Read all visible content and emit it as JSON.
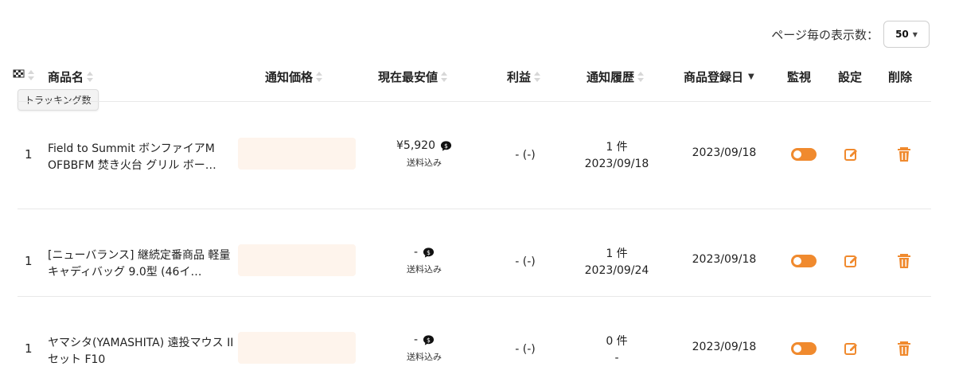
{
  "pagination": {
    "per_page_label": "ページ毎の表示数：",
    "per_page_value": "50"
  },
  "columns": {
    "tracking": "",
    "product_name": "商品名",
    "notify_price": "通知価格",
    "lowest_price": "現在最安値",
    "profit": "利益",
    "notify_history": "通知履歴",
    "register_date": "商品登録日",
    "monitor": "監視",
    "settings": "設定",
    "delete": "削除"
  },
  "tooltip": {
    "text": "トラッキング数"
  },
  "icons": {
    "tracking": "checkered-flag-icon",
    "sort": "sort-icon",
    "sort_active": "sort-down-icon",
    "lowest_price_badge": "speech-bubble-dollar-icon",
    "edit": "edit-icon",
    "delete": "trash-icon"
  },
  "colors": {
    "accent": "#F08A2E",
    "price_box_bg": "#FEF4EC",
    "divider": "#E8E8E8"
  },
  "rows": [
    {
      "count": "1",
      "product_name": "Field to Summit ボンファイアM OFBBFM 焚き火台 グリル ボー…",
      "notify_price": "",
      "lowest_price": "¥5,920",
      "shipping": "送料込み",
      "profit": "- (-)",
      "history_count": "1 件",
      "history_date": "2023/09/18",
      "register_date": "2023/09/18",
      "monitor_on": true
    },
    {
      "count": "1",
      "product_name": "[ニューバランス] 継続定番商品 軽量 キャディバッグ 9.0型 (46イ…",
      "notify_price": "",
      "lowest_price": "-",
      "shipping": "送料込み",
      "profit": "- (-)",
      "history_count": "1 件",
      "history_date": "2023/09/24",
      "register_date": "2023/09/18",
      "monitor_on": true
    },
    {
      "count": "1",
      "product_name": "ヤマシタ(YAMASHITA) 遠投マウス IIセット F10",
      "notify_price": "",
      "lowest_price": "-",
      "shipping": "送料込み",
      "profit": "- (-)",
      "history_count": "0 件",
      "history_date": "-",
      "register_date": "2023/09/18",
      "monitor_on": true
    }
  ]
}
